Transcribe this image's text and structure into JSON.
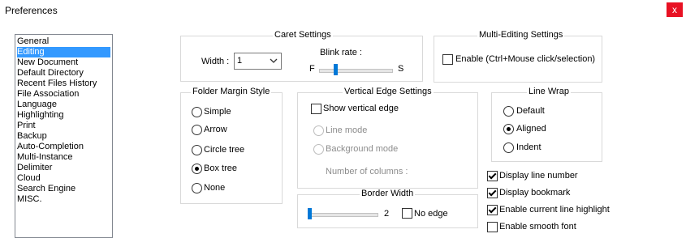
{
  "window": {
    "title": "Preferences",
    "close_label": "x"
  },
  "categories": [
    "General",
    "Editing",
    "New Document",
    "Default Directory",
    "Recent Files History",
    "File Association",
    "Language",
    "Highlighting",
    "Print",
    "Backup",
    "Auto-Completion",
    "Multi-Instance",
    "Delimiter",
    "Cloud",
    "Search Engine",
    "MISC."
  ],
  "selected_category": "Editing",
  "caret": {
    "title": "Caret Settings",
    "width_label": "Width :",
    "width_value": "1",
    "blink_label": "Blink rate :",
    "blink_min": "F",
    "blink_max": "S",
    "blink_level": 0.2
  },
  "multi_edit": {
    "title": "Multi-Editing Settings",
    "enable_label": "Enable (Ctrl+Mouse click/selection)",
    "checked": false
  },
  "folder_margin": {
    "title": "Folder Margin Style",
    "options": [
      "Simple",
      "Arrow",
      "Circle tree",
      "Box tree",
      "None"
    ],
    "selected": "Box tree"
  },
  "vertical_edge": {
    "title": "Vertical Edge Settings",
    "show_label": "Show vertical edge",
    "checked": false,
    "line_mode": "Line mode",
    "background_mode": "Background mode",
    "columns_label": "Number of columns :"
  },
  "line_wrap": {
    "title": "Line Wrap",
    "options": [
      "Default",
      "Aligned",
      "Indent"
    ],
    "selected": "Aligned"
  },
  "border_width": {
    "title": "Border Width",
    "value": "2",
    "no_edge_label": "No edge",
    "no_edge_checked": false,
    "level": 0.0
  },
  "checkboxes": [
    {
      "label": "Display line number",
      "checked": true
    },
    {
      "label": "Display bookmark",
      "checked": true
    },
    {
      "label": "Enable current line highlight",
      "checked": true
    },
    {
      "label": "Enable smooth font",
      "checked": false
    }
  ]
}
